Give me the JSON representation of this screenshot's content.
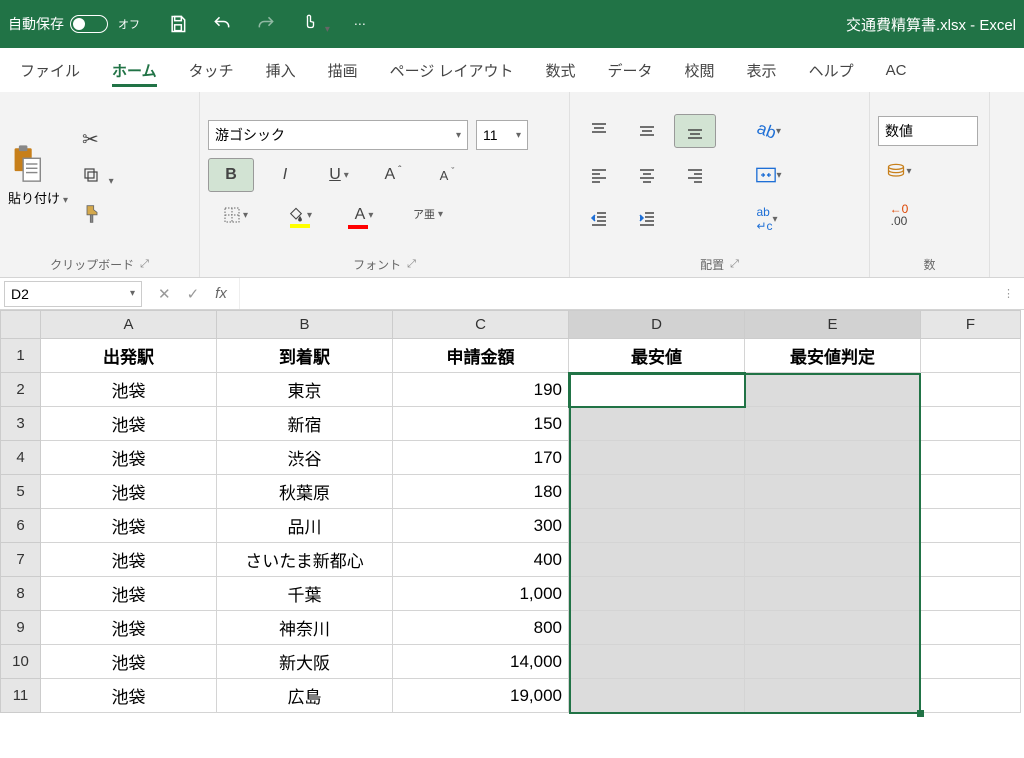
{
  "titlebar": {
    "autosave_label": "自動保存",
    "autosave_state": "オフ",
    "title": "交通費精算書.xlsx  -  Excel"
  },
  "tabs": {
    "file": "ファイル",
    "home": "ホーム",
    "touch": "タッチ",
    "insert": "挿入",
    "draw": "描画",
    "layout": "ページ レイアウト",
    "formulas": "数式",
    "data": "データ",
    "review": "校閲",
    "view": "表示",
    "help": "ヘルプ",
    "acrobat": "AC"
  },
  "ribbon": {
    "paste_label": "貼り付け",
    "clipboard_group": "クリップボード",
    "font_name": "游ゴシック",
    "font_size": "11",
    "font_group": "フォント",
    "align_group": "配置",
    "number_format": "数値",
    "number_group": "数",
    "ruby_label": "ア亜"
  },
  "namebox": "D2",
  "headers": {
    "A": "出発駅",
    "B": "到着駅",
    "C": "申請金額",
    "D": "最安値",
    "E": "最安値判定"
  },
  "rows": [
    {
      "a": "池袋",
      "b": "東京",
      "c": "190"
    },
    {
      "a": "池袋",
      "b": "新宿",
      "c": "150"
    },
    {
      "a": "池袋",
      "b": "渋谷",
      "c": "170"
    },
    {
      "a": "池袋",
      "b": "秋葉原",
      "c": "180"
    },
    {
      "a": "池袋",
      "b": "品川",
      "c": "300"
    },
    {
      "a": "池袋",
      "b": "さいたま新都心",
      "c": "400"
    },
    {
      "a": "池袋",
      "b": "千葉",
      "c": "1,000"
    },
    {
      "a": "池袋",
      "b": "神奈川",
      "c": "800"
    },
    {
      "a": "池袋",
      "b": "新大阪",
      "c": "14,000"
    },
    {
      "a": "池袋",
      "b": "広島",
      "c": "19,000"
    }
  ],
  "cols": [
    "A",
    "B",
    "C",
    "D",
    "E",
    "F"
  ]
}
